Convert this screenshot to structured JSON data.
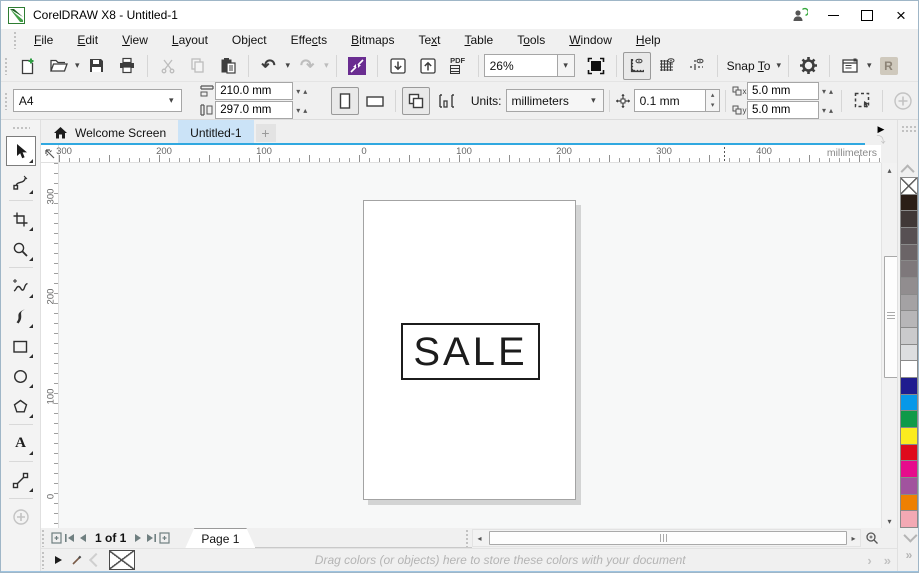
{
  "window": {
    "title": "CorelDRAW X8 - Untitled-1"
  },
  "menubar": {
    "items": [
      {
        "label": "File",
        "u": 0
      },
      {
        "label": "Edit",
        "u": 0
      },
      {
        "label": "View",
        "u": 0
      },
      {
        "label": "Layout",
        "u": 0
      },
      {
        "label": "Object",
        "u": 2
      },
      {
        "label": "Effects",
        "u": 4
      },
      {
        "label": "Bitmaps",
        "u": 0
      },
      {
        "label": "Text",
        "u": 2
      },
      {
        "label": "Table",
        "u": 0
      },
      {
        "label": "Tools",
        "u": 1
      },
      {
        "label": "Window",
        "u": 0
      },
      {
        "label": "Help",
        "u": 0
      }
    ]
  },
  "toolbar": {
    "zoom_value": "26%",
    "pdf_label": "PDF",
    "snap_to": {
      "label": "Snap To",
      "u": 5
    }
  },
  "propbar": {
    "paper_type": "A4",
    "page_width": "210.0 mm",
    "page_height": "297.0 mm",
    "units_label": "Units:",
    "units_value": "millimeters",
    "nudge_distance": "0.1 mm",
    "duplicate_x": "5.0 mm",
    "duplicate_y": "5.0 mm",
    "dup_x_sub": "x",
    "dup_y_sub": "y"
  },
  "tabs": {
    "welcome_label": "Welcome Screen",
    "document_label": "Untitled-1",
    "new_tab_label": "+"
  },
  "rulers": {
    "h_labels": [
      "300",
      "200",
      "100",
      "0",
      "100",
      "200",
      "300",
      "400"
    ],
    "v_labels": [
      "300",
      "200",
      "100",
      "0"
    ],
    "unit_text": "millimeters"
  },
  "canvas": {
    "sale_text": "SALE"
  },
  "palette": {
    "swatches": [
      "none",
      "#2b1e17",
      "#403837",
      "#575053",
      "#6b6467",
      "#7e787b",
      "#918d8f",
      "#a4a2a4",
      "#b7b6b8",
      "#cacacc",
      "#dddee0",
      "#ffffff",
      "#1f1c8f",
      "#0798e8",
      "#0f9a49",
      "#fbec1f",
      "#df0b1c",
      "#e60c8c",
      "#a1539e",
      "#ee8002",
      "#f3a9b4"
    ]
  },
  "navigator": {
    "page_info": "1 of 1",
    "page_tab_label": "Page 1"
  },
  "statusbar": {
    "hint": "Drag colors (or objects) here to store these colors with your document"
  },
  "glyphs": {
    "dropdown": "▾",
    "spin_down": "▾",
    "spin_up": "▴",
    "undo": "↶",
    "redo": "↷",
    "close": "×",
    "plus": "+",
    "status_next": "›",
    "status_more": "»",
    "palette_more": "»",
    "launcher_letter": "R",
    "up_small": "▴",
    "down_small": "▾",
    "left_small": "◂",
    "right_small": "▸"
  }
}
